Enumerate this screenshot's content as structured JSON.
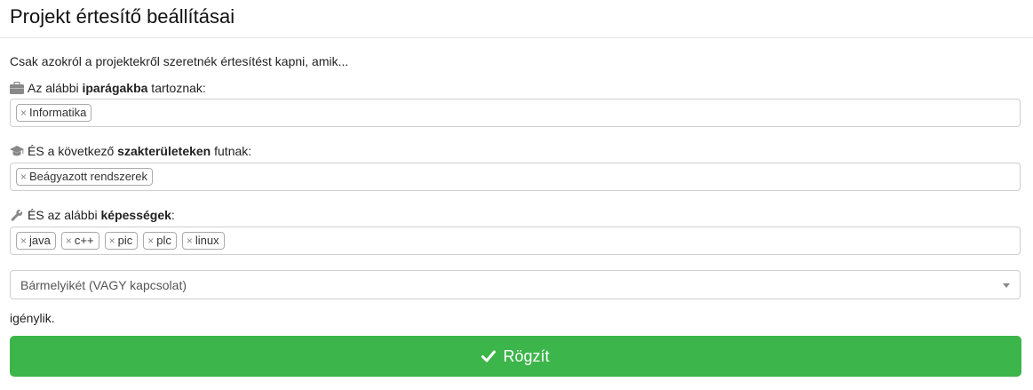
{
  "page": {
    "title": "Projekt értesítő beállításai"
  },
  "intro": "Csak azokról a projektekről szeretnék értesítést kapni, amik...",
  "industries": {
    "label_pre": "Az alábbi ",
    "label_bold": "iparágakba",
    "label_post": " tartoznak:",
    "icon": "briefcase-icon",
    "tags": [
      "Informatika"
    ]
  },
  "fields": {
    "label_pre": "ÉS a következő ",
    "label_bold": "szakterületeken",
    "label_post": " futnak:",
    "icon": "graduation-cap-icon",
    "tags": [
      "Beágyazott rendszerek"
    ]
  },
  "skills": {
    "label_pre": "ÉS az alábbi ",
    "label_bold": "képességek",
    "label_post": ":",
    "icon": "wrench-icon",
    "tags": [
      "java",
      "c++",
      "pic",
      "plc",
      "linux"
    ]
  },
  "tag_remove_symbol": "×",
  "match_mode": {
    "selected": "Bármelyikét (VAGY kapcsolat)"
  },
  "requires_text": "igénylik.",
  "submit": {
    "label": "Rögzít",
    "color": "#3cb54a"
  }
}
